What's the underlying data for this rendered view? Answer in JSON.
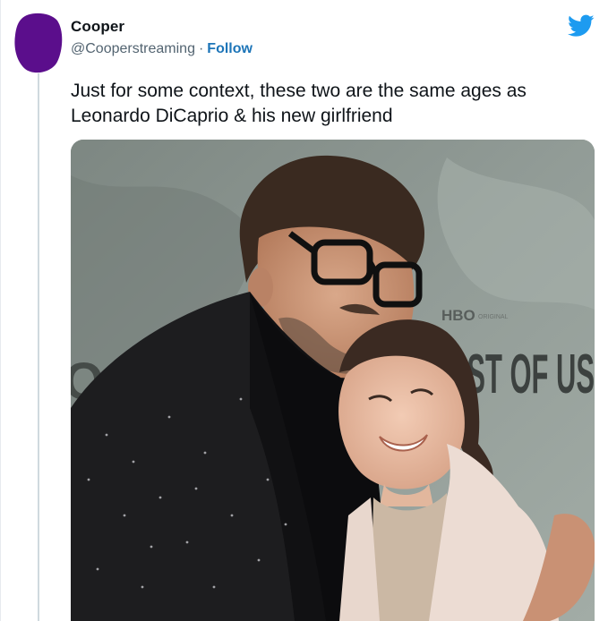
{
  "tweet": {
    "author": {
      "display_name": "Cooper",
      "handle": "@Cooperstreaming",
      "separator": "·",
      "follow_label": "Follow",
      "avatar_color": "#5b0e8c"
    },
    "brand_icon": "twitter-bird-icon",
    "brand_color": "#1d9bf0",
    "text": "Just for some context, these two are the same ages as Leonardo DiCaprio & his new girlfriend",
    "media": {
      "backdrop_logo": "HBO",
      "backdrop_logo_sub": "ORIGINAL",
      "backdrop_title": "AST OF US",
      "backdrop_partial_left": "O"
    }
  }
}
